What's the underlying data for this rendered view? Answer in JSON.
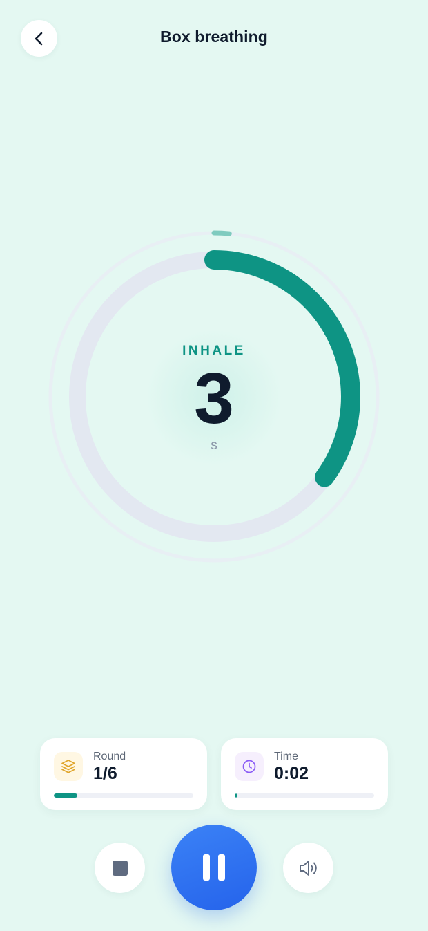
{
  "header": {
    "title": "Box breathing",
    "back_icon": "chevron-left-icon"
  },
  "breath": {
    "phase": "INHALE",
    "count": "3",
    "unit": "s",
    "phase_progress": 0.35,
    "session_progress": 0.015
  },
  "stats": {
    "round": {
      "label": "Round",
      "value": "1/6",
      "icon": "layers-icon",
      "progress": 0.17
    },
    "time": {
      "label": "Time",
      "value": "0:02",
      "icon": "clock-icon",
      "progress": 0.01
    }
  },
  "controls": {
    "stop_icon": "stop-icon",
    "pause_icon": "pause-icon",
    "sound_icon": "speaker-icon"
  },
  "colors": {
    "background": "#e4f8f2",
    "accent_teal": "#0e9484",
    "primary_blue": "#2563eb",
    "round_icon": "#e0a52a",
    "time_icon": "#8b5cf6"
  }
}
